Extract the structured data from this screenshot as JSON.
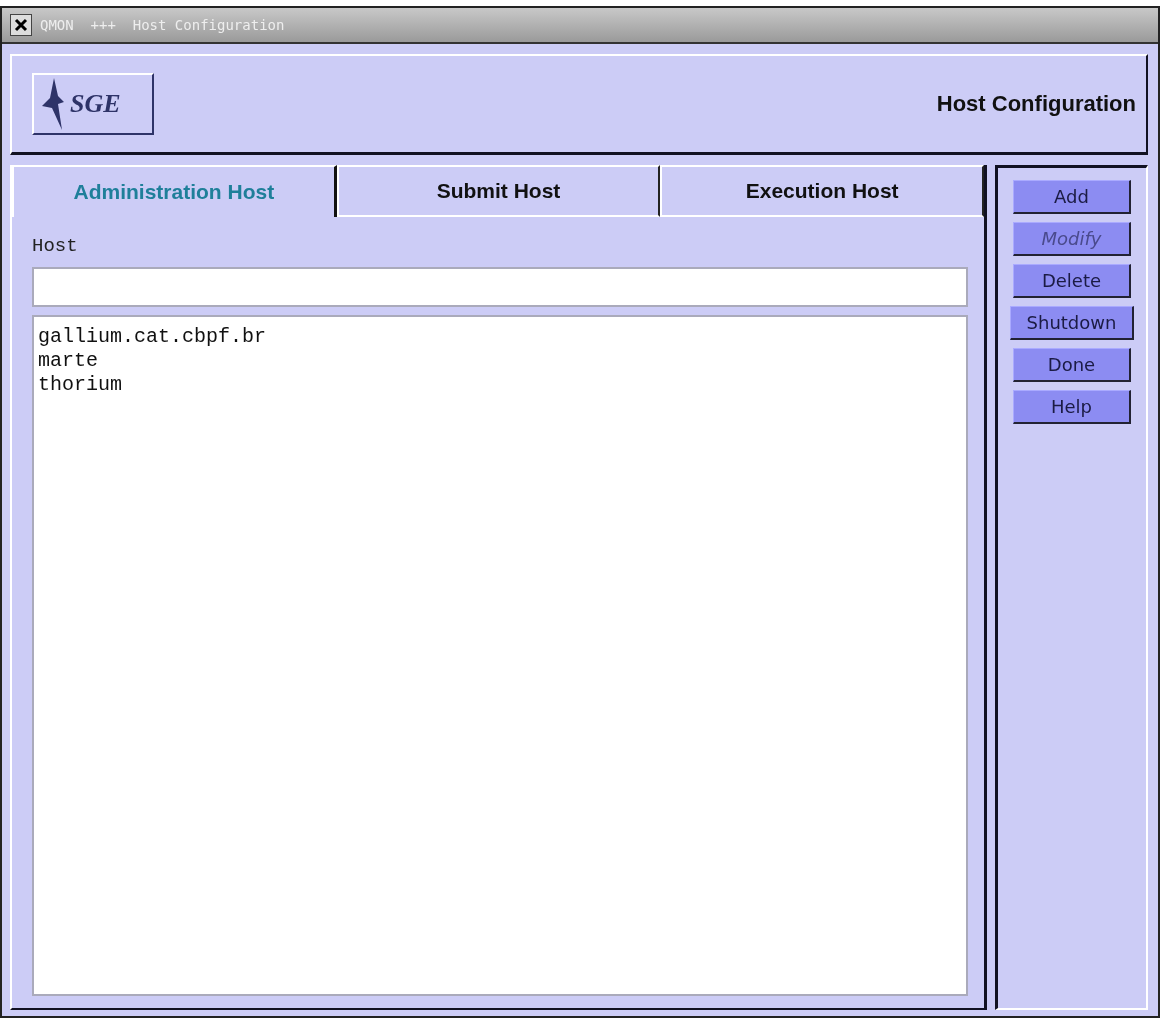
{
  "window": {
    "title": "QMON  +++  Host Configuration"
  },
  "header": {
    "logo_text": "SGE",
    "title": "Host Configuration"
  },
  "tabs": [
    {
      "label": "Administration Host",
      "selected": true
    },
    {
      "label": "Submit Host",
      "selected": false
    },
    {
      "label": "Execution Host",
      "selected": false
    }
  ],
  "host_field": {
    "label": "Host"
  },
  "hosts": [
    "gallium.cat.cbpf.br",
    "marte",
    "thorium"
  ],
  "buttons": [
    {
      "label": "Add",
      "disabled": false
    },
    {
      "label": "Modify",
      "disabled": true
    },
    {
      "label": "Delete",
      "disabled": false
    },
    {
      "label": "Shutdown",
      "disabled": false
    },
    {
      "label": "Done",
      "disabled": false
    },
    {
      "label": "Help",
      "disabled": false
    }
  ]
}
